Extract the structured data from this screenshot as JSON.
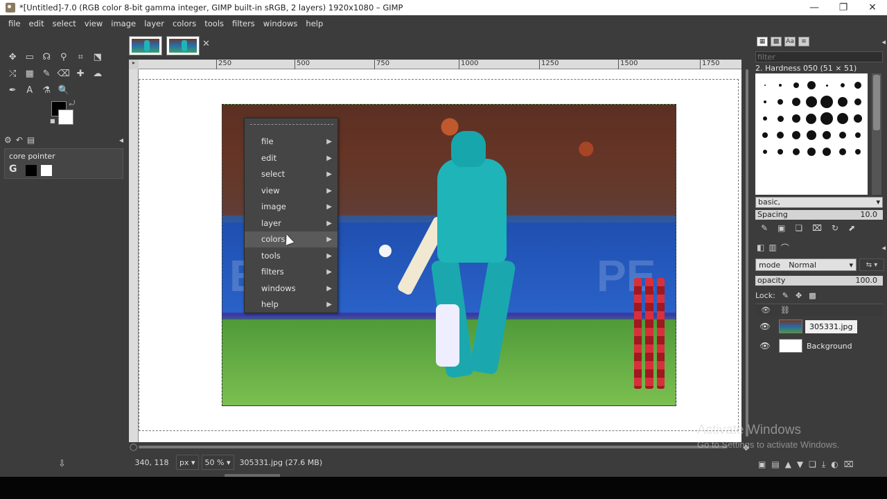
{
  "window": {
    "title": "*[Untitled]-7.0 (RGB color 8-bit gamma integer, GIMP built-in sRGB, 2 layers) 1920x1080 – GIMP",
    "minimize": "—",
    "restore": "❐",
    "close": "✕"
  },
  "menubar": [
    "file",
    "edit",
    "select",
    "view",
    "image",
    "layer",
    "colors",
    "tools",
    "filters",
    "windows",
    "help"
  ],
  "toolbox": {
    "tools": [
      {
        "name": "move-tool-icon",
        "glyph": "✥"
      },
      {
        "name": "rect-select-icon",
        "glyph": "▭"
      },
      {
        "name": "free-select-icon",
        "glyph": "☊"
      },
      {
        "name": "fuzzy-select-icon",
        "glyph": "⚲"
      },
      {
        "name": "crop-icon",
        "glyph": "⌗"
      },
      {
        "name": "unified-transform-icon",
        "glyph": "⬔"
      },
      {
        "name": "warp-transform-icon",
        "glyph": "⤭"
      },
      {
        "name": "gradient-icon",
        "glyph": "▦"
      },
      {
        "name": "paintbrush-icon",
        "glyph": "✎"
      },
      {
        "name": "eraser-icon",
        "glyph": "⌫"
      },
      {
        "name": "heal-icon",
        "glyph": "✚"
      },
      {
        "name": "smudge-icon",
        "glyph": "☁"
      },
      {
        "name": "paths-icon",
        "glyph": "✒"
      },
      {
        "name": "text-tool-icon",
        "glyph": "A"
      },
      {
        "name": "color-picker-icon",
        "glyph": "⚗"
      },
      {
        "name": "zoom-icon",
        "glyph": "🔍"
      }
    ],
    "pointer_panel_label": "core pointer",
    "pointer_glyph": "G"
  },
  "canvas": {
    "ruler_ticks": [
      {
        "label": "250",
        "pos": 112
      },
      {
        "label": "500",
        "pos": 225
      },
      {
        "label": "750",
        "pos": 340
      },
      {
        "label": "1000",
        "pos": 462
      },
      {
        "label": "1250",
        "pos": 578
      },
      {
        "label": "1500",
        "pos": 692
      },
      {
        "label": "1750",
        "pos": 810
      }
    ],
    "hoarding_text_left": "EET",
    "hoarding_text_right": "PE"
  },
  "context_menu": {
    "items": [
      {
        "label": "file",
        "highlighted": false
      },
      {
        "label": "edit",
        "highlighted": false
      },
      {
        "label": "select",
        "highlighted": false
      },
      {
        "label": "view",
        "highlighted": false
      },
      {
        "label": "image",
        "highlighted": false
      },
      {
        "label": "layer",
        "highlighted": false
      },
      {
        "label": "colors",
        "highlighted": true
      },
      {
        "label": "tools",
        "highlighted": false
      },
      {
        "label": "filters",
        "highlighted": false
      },
      {
        "label": "windows",
        "highlighted": false
      },
      {
        "label": "help",
        "highlighted": false
      }
    ]
  },
  "statusbar": {
    "coords": "340, 118",
    "unit": "px",
    "zoom": "50 %",
    "file_info": "305331.jpg (27.6 MB)"
  },
  "brushes": {
    "filter_placeholder": "filter",
    "current": "2. Hardness 050 (51 × 51)",
    "tag": "basic,",
    "spacing_label": "Spacing",
    "spacing_value": "10.0"
  },
  "layers": {
    "mode_label": "mode",
    "mode_value": "Normal",
    "opacity_label": "opacity",
    "opacity_value": "100.0",
    "lock_label": "Lock:",
    "items": [
      {
        "name": "305331.jpg",
        "selected": true
      },
      {
        "name": "Background",
        "selected": false
      }
    ]
  },
  "watermark": {
    "line1": "Activate Windows",
    "line2": "Go to Settings to activate Windows."
  }
}
